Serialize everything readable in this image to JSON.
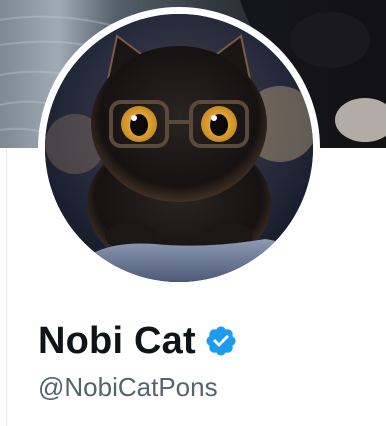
{
  "profile": {
    "display_name": "Nobi Cat",
    "handle": "@NobiCatPons",
    "verified": true,
    "verified_badge_icon": "verified-badge-icon",
    "accent_color": "#1d9bf0",
    "name_color": "#0f1419",
    "handle_color": "#536471"
  }
}
